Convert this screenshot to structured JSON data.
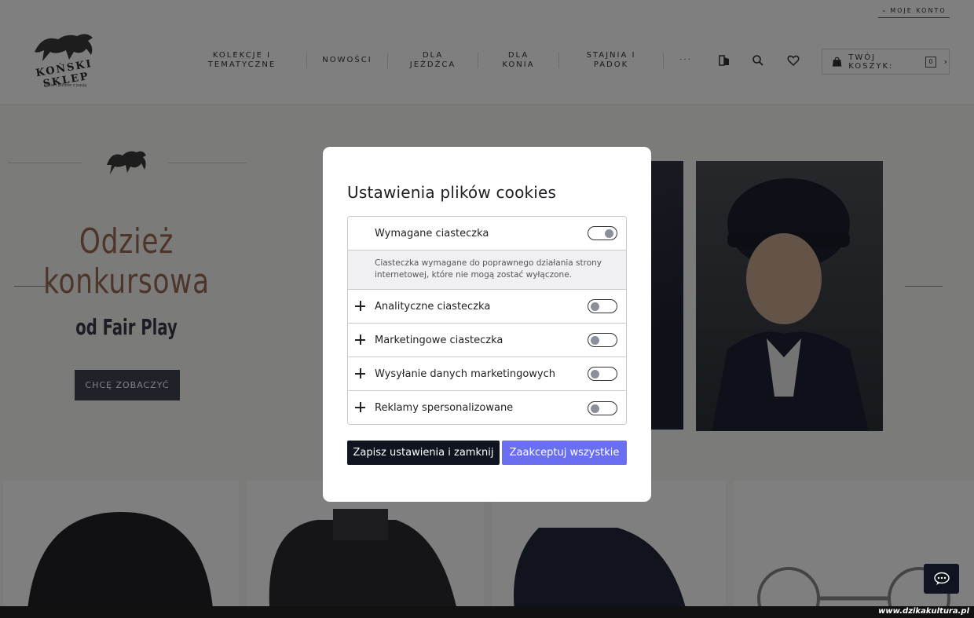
{
  "header": {
    "account_label": "MOJE KONTO",
    "logo_text": "KOŃSKI SKLEP",
    "logo_tagline": "konie i jeździe z pasją",
    "nav": [
      "KOLEKCJE I\nTEMATYCZNE",
      "NOWOŚCI",
      "DLA\nJEŹDŹCA",
      "DLA\nKONIA",
      "STAJNIA I\nPADOK",
      "···"
    ],
    "cart_label": "TWÓJ KOSZYK:",
    "cart_count": "0"
  },
  "hero": {
    "title": "Odzież konkursowa",
    "subtitle": "od Fair Play",
    "cta": "CHCĘ ZOBACZYĆ"
  },
  "cookie_modal": {
    "title": "Ustawienia plików cookies",
    "categories": [
      {
        "label": "Wymagane ciasteczka",
        "enabled": true,
        "expanded": true,
        "description": "Ciasteczka wymagane do poprawnego działania strony internetowej, które nie mogą zostać wyłączone."
      },
      {
        "label": "Analityczne ciasteczka",
        "enabled": false,
        "expanded": false
      },
      {
        "label": "Marketingowe ciasteczka",
        "enabled": false,
        "expanded": false
      },
      {
        "label": "Wysyłanie danych marketingowych",
        "enabled": false,
        "expanded": false
      },
      {
        "label": "Reklamy spersonalizowane",
        "enabled": false,
        "expanded": false
      }
    ],
    "save_button": "Zapisz ustawienia i zamknij",
    "accept_button": "Zaakceptuj wszystkie"
  },
  "watermark": "www.dzikakultura.pl",
  "colors": {
    "accent": "#6a6ef0",
    "dark_button": "#0f1420",
    "hero_title": "#9a6a55"
  },
  "icons": {
    "account_chevron": "chevron-down-icon",
    "nav_compare": "compare-icon",
    "nav_search": "search-icon",
    "nav_wishlist": "heart-icon",
    "cart": "shopping-bag-icon",
    "cart_arrow": "chevron-right-icon",
    "category_expand": "plus-icon",
    "chat": "chat-icon"
  }
}
